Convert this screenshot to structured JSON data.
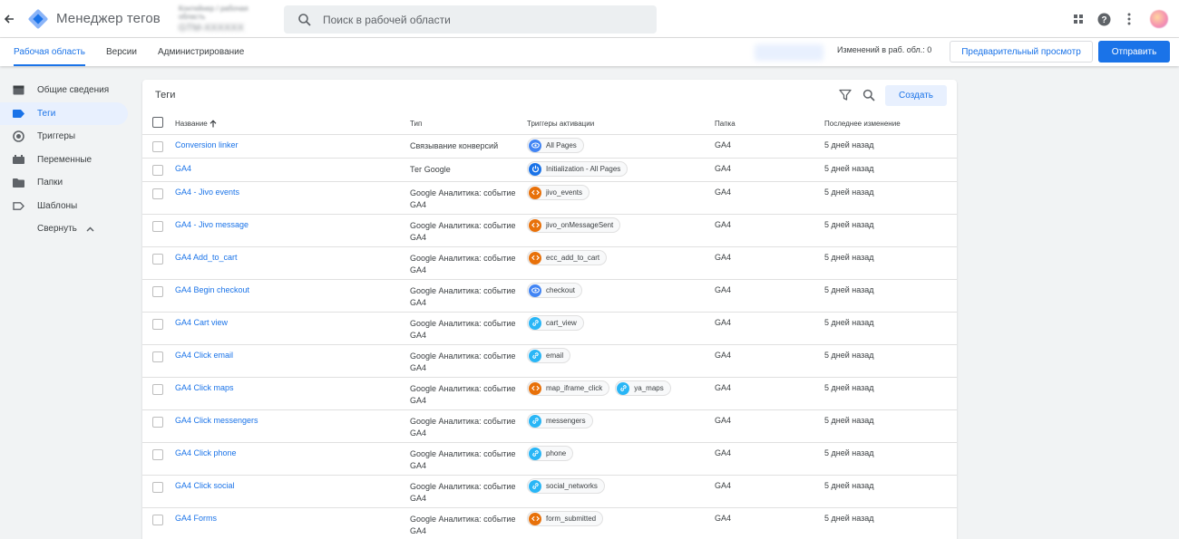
{
  "app": {
    "back_icon": "arrow-left-icon",
    "title": "Менеджер тегов",
    "account_small": "Контейнер / рабочая область",
    "account_name": "GTM-XXXXXX",
    "search_placeholder": "Поиск в рабочей области"
  },
  "nav": {
    "tabs": [
      "Рабочая область",
      "Версии",
      "Администрирование"
    ],
    "changes": "Изменений в раб. обл.: 0",
    "preview_label": "Предварительный просмотр",
    "submit_label": "Отправить"
  },
  "sidebar": {
    "items": [
      {
        "label": "Общие сведения",
        "icon": "overview-icon"
      },
      {
        "label": "Теги",
        "icon": "tag-icon"
      },
      {
        "label": "Триггеры",
        "icon": "trigger-icon"
      },
      {
        "label": "Переменные",
        "icon": "variable-icon"
      },
      {
        "label": "Папки",
        "icon": "folder-icon"
      },
      {
        "label": "Шаблоны",
        "icon": "template-icon"
      }
    ],
    "collapse_label": "Свернуть"
  },
  "card": {
    "title": "Теги",
    "create_label": "Создать",
    "columns": {
      "name": "Название",
      "type": "Тип",
      "triggers": "Триггеры активации",
      "folder": "Папка",
      "modified": "Последнее изменение"
    },
    "rows": [
      {
        "name": "Conversion linker",
        "type": "Связывание конверсий",
        "triggers": [
          {
            "label": "All Pages",
            "kind": "pv"
          }
        ],
        "folder": "GA4",
        "modified": "5 дней назад"
      },
      {
        "name": "GA4",
        "type": "Тег Google",
        "triggers": [
          {
            "label": "Initialization - All Pages",
            "kind": "init"
          }
        ],
        "folder": "GA4",
        "modified": "5 дней назад"
      },
      {
        "name": "GA4 - Jivo events",
        "type": "Google Аналитика: событие GA4",
        "triggers": [
          {
            "label": "jivo_events",
            "kind": "custom"
          }
        ],
        "folder": "GA4",
        "modified": "5 дней назад"
      },
      {
        "name": "GA4 - Jivo message",
        "type": "Google Аналитика: событие GA4",
        "triggers": [
          {
            "label": "jivo_onMessageSent",
            "kind": "custom"
          }
        ],
        "folder": "GA4",
        "modified": "5 дней назад"
      },
      {
        "name": "GA4 Add_to_cart",
        "type": "Google Аналитика: событие GA4",
        "triggers": [
          {
            "label": "ecc_add_to_cart",
            "kind": "custom"
          }
        ],
        "folder": "GA4",
        "modified": "5 дней назад"
      },
      {
        "name": "GA4 Begin checkout",
        "type": "Google Аналитика: событие GA4",
        "triggers": [
          {
            "label": "checkout",
            "kind": "pv"
          }
        ],
        "folder": "GA4",
        "modified": "5 дней назад"
      },
      {
        "name": "GA4 Cart view",
        "type": "Google Аналитика: событие GA4",
        "triggers": [
          {
            "label": "cart_view",
            "kind": "link"
          }
        ],
        "folder": "GA4",
        "modified": "5 дней назад"
      },
      {
        "name": "GA4 Click email",
        "type": "Google Аналитика: событие GA4",
        "triggers": [
          {
            "label": "email",
            "kind": "link"
          }
        ],
        "folder": "GA4",
        "modified": "5 дней назад"
      },
      {
        "name": "GA4 Click maps",
        "type": "Google Аналитика: событие GA4",
        "triggers": [
          {
            "label": "map_iframe_click",
            "kind": "custom"
          },
          {
            "label": "ya_maps",
            "kind": "link"
          }
        ],
        "folder": "GA4",
        "modified": "5 дней назад"
      },
      {
        "name": "GA4 Click messengers",
        "type": "Google Аналитика: событие GA4",
        "triggers": [
          {
            "label": "messengers",
            "kind": "link"
          }
        ],
        "folder": "GA4",
        "modified": "5 дней назад"
      },
      {
        "name": "GA4 Click phone",
        "type": "Google Аналитика: событие GA4",
        "triggers": [
          {
            "label": "phone",
            "kind": "link"
          }
        ],
        "folder": "GA4",
        "modified": "5 дней назад"
      },
      {
        "name": "GA4 Click social",
        "type": "Google Аналитика: событие GA4",
        "triggers": [
          {
            "label": "social_networks",
            "kind": "link"
          }
        ],
        "folder": "GA4",
        "modified": "5 дней назад"
      },
      {
        "name": "GA4 Forms",
        "type": "Google Аналитика: событие GA4",
        "triggers": [
          {
            "label": "form_submitted",
            "kind": "custom"
          }
        ],
        "folder": "GA4",
        "modified": "5 дней назад"
      }
    ]
  },
  "colors": {
    "accent": "#1a73e8",
    "pageview_trigger": "#4285f4",
    "custom_trigger": "#e8710a",
    "link_trigger": "#29b6f6"
  }
}
